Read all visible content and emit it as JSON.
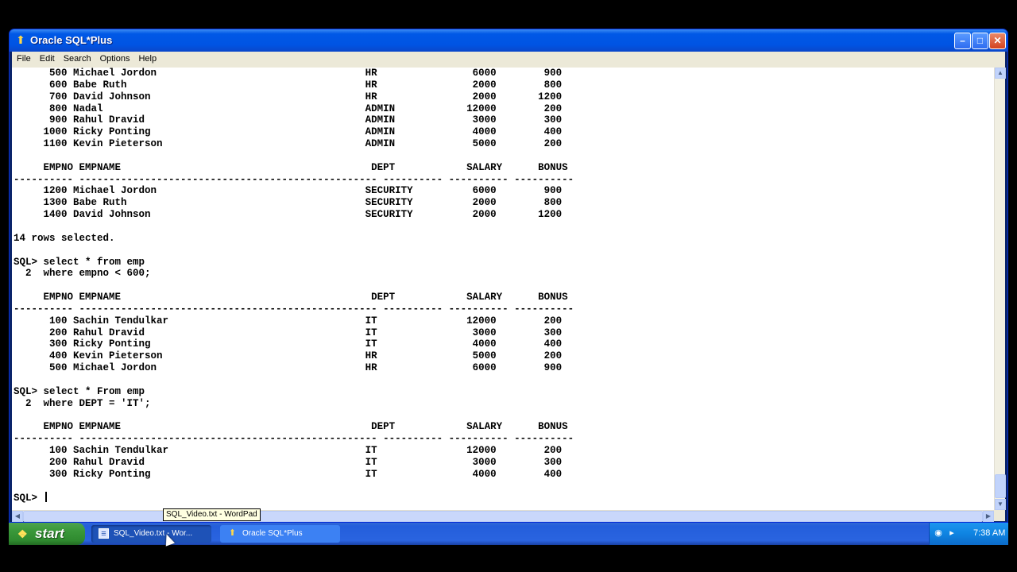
{
  "window": {
    "title": "Oracle SQL*Plus",
    "minimize": "–",
    "maximize": "□",
    "close": "✕"
  },
  "menu": [
    "File",
    "Edit",
    "Search",
    "Options",
    "Help"
  ],
  "console": {
    "lines": [
      "      500 Michael Jordon                                   HR                6000        900",
      "      600 Babe Ruth                                        HR                2000        800",
      "      700 David Johnson                                    HR                2000       1200",
      "      800 Nadal                                            ADMIN            12000        200",
      "      900 Rahul Dravid                                     ADMIN             3000        300",
      "     1000 Ricky Ponting                                    ADMIN             4000        400",
      "     1100 Kevin Pieterson                                  ADMIN             5000        200",
      "",
      "     EMPNO EMPNAME                                          DEPT            SALARY      BONUS",
      "---------- -------------------------------------------------- ---------- ---------- ----------",
      "     1200 Michael Jordon                                   SECURITY          6000        900",
      "     1300 Babe Ruth                                        SECURITY          2000        800",
      "     1400 David Johnson                                    SECURITY          2000       1200",
      "",
      "14 rows selected.",
      "",
      "SQL> select * from emp",
      "  2  where empno < 600;",
      "",
      "     EMPNO EMPNAME                                          DEPT            SALARY      BONUS",
      "---------- -------------------------------------------------- ---------- ---------- ----------",
      "      100 Sachin Tendulkar                                 IT               12000        200",
      "      200 Rahul Dravid                                     IT                3000        300",
      "      300 Ricky Ponting                                    IT                4000        400",
      "      400 Kevin Pieterson                                  HR                5000        200",
      "      500 Michael Jordon                                   HR                6000        900",
      "",
      "SQL> select * From emp",
      "  2  where DEPT = 'IT';",
      "",
      "     EMPNO EMPNAME                                          DEPT            SALARY      BONUS",
      "---------- -------------------------------------------------- ---------- ---------- ----------",
      "      100 Sachin Tendulkar                                 IT               12000        200",
      "      200 Rahul Dravid                                     IT                3000        300",
      "      300 Ricky Ponting                                    IT                4000        400",
      ""
    ],
    "prompt": "SQL> "
  },
  "tooltip": "SQL_Video.txt - WordPad",
  "taskbar": {
    "start_label": "start",
    "tasks": [
      {
        "label": "SQL_Video.txt - Wor..."
      },
      {
        "label": "Oracle SQL*Plus"
      }
    ],
    "clock": "7:38 AM"
  },
  "colors": {
    "titlebar": "#0054e3",
    "taskbar": "#245edb",
    "start_button": "#3c9a3c",
    "console_bg": "#ffffff"
  }
}
